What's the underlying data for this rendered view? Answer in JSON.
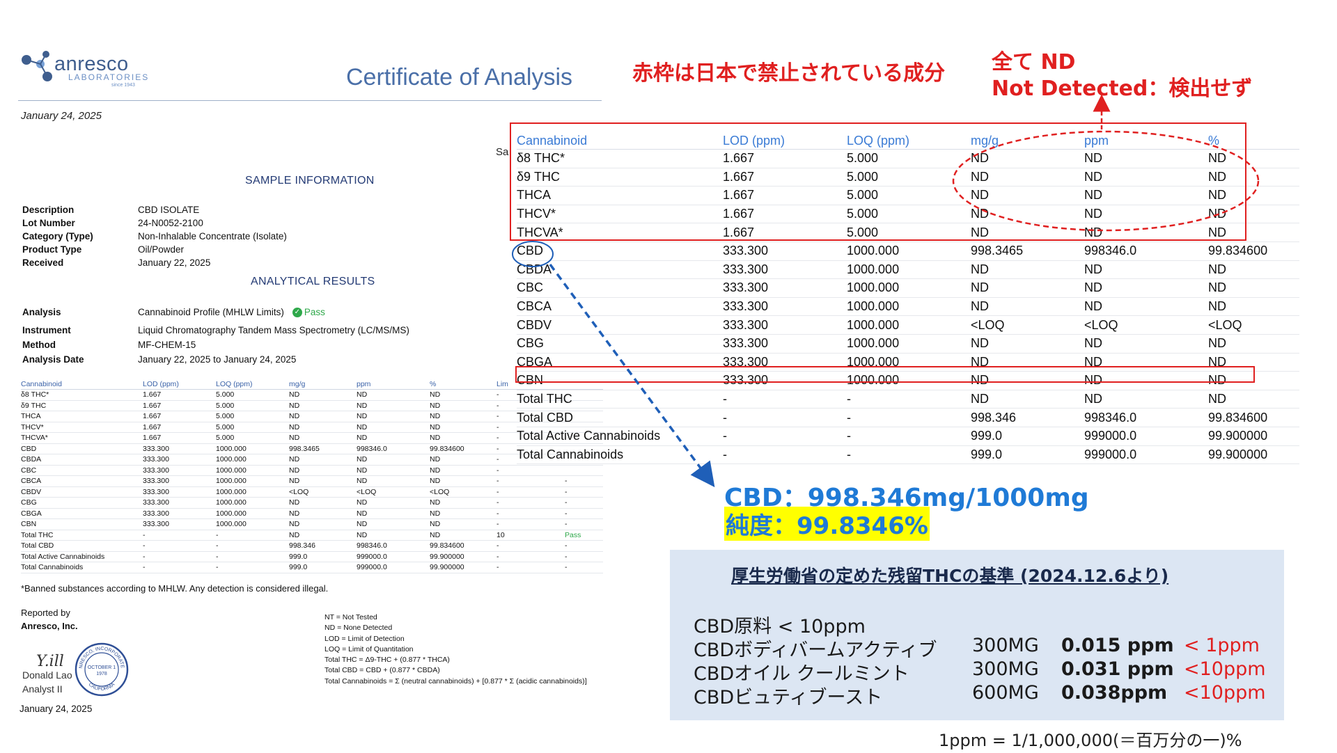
{
  "logo": {
    "word": "anresco",
    "sub": "LABORATORIES",
    "since": "since 1943"
  },
  "certificate": {
    "title": "Certificate of Analysis",
    "date": "January 24, 2025",
    "sample_heading": "SAMPLE INFORMATION",
    "cut_text": "Sa",
    "info": [
      {
        "label": "Description",
        "value": "CBD ISOLATE"
      },
      {
        "label": "Lot Number",
        "value": "24-N0052-2100"
      },
      {
        "label": "Category (Type)",
        "value": "Non-Inhalable Concentrate (Isolate)"
      },
      {
        "label": "Product Type",
        "value": "Oil/Powder"
      },
      {
        "label": "Received",
        "value": "January 22, 2025"
      }
    ],
    "results_heading": "ANALYTICAL RESULTS",
    "analysis": [
      {
        "label": "Analysis",
        "value": "Cannabinoid Profile (MHLW Limits)",
        "badge": "Pass"
      },
      {
        "label": "Instrument",
        "value": "Liquid Chromatography Tandem Mass Spectrometry (LC/MS/MS)"
      },
      {
        "label": "Method",
        "value": "MF-CHEM-15"
      },
      {
        "label": "Analysis Date",
        "value": "January 22, 2025 to January 24, 2025"
      }
    ],
    "table_headers": [
      "Cannabinoid",
      "LOD (ppm)",
      "LOQ (ppm)",
      "mg/g",
      "ppm",
      "%",
      "Lim",
      "",
      ""
    ],
    "table_rows": [
      [
        "δ8 THC*",
        "1.667",
        "5.000",
        "ND",
        "ND",
        "ND",
        "-",
        "",
        ""
      ],
      [
        "δ9 THC",
        "1.667",
        "5.000",
        "ND",
        "ND",
        "ND",
        "-",
        "",
        ""
      ],
      [
        "THCA",
        "1.667",
        "5.000",
        "ND",
        "ND",
        "ND",
        "-",
        "",
        ""
      ],
      [
        "THCV*",
        "1.667",
        "5.000",
        "ND",
        "ND",
        "ND",
        "-",
        "",
        ""
      ],
      [
        "THCVA*",
        "1.667",
        "5.000",
        "ND",
        "ND",
        "ND",
        "-",
        "",
        ""
      ],
      [
        "CBD",
        "333.300",
        "1000.000",
        "998.3465",
        "998346.0",
        "99.834600",
        "-",
        "",
        ""
      ],
      [
        "CBDA",
        "333.300",
        "1000.000",
        "ND",
        "ND",
        "ND",
        "-",
        "",
        ""
      ],
      [
        "CBC",
        "333.300",
        "1000.000",
        "ND",
        "ND",
        "ND",
        "-",
        "",
        ""
      ],
      [
        "CBCA",
        "333.300",
        "1000.000",
        "ND",
        "ND",
        "ND",
        "-",
        "",
        "-"
      ],
      [
        "CBDV",
        "333.300",
        "1000.000",
        "<LOQ",
        "<LOQ",
        "<LOQ",
        "-",
        "",
        "-"
      ],
      [
        "CBG",
        "333.300",
        "1000.000",
        "ND",
        "ND",
        "ND",
        "-",
        "",
        "-"
      ],
      [
        "CBGA",
        "333.300",
        "1000.000",
        "ND",
        "ND",
        "ND",
        "-",
        "",
        "-"
      ],
      [
        "CBN",
        "333.300",
        "1000.000",
        "ND",
        "ND",
        "ND",
        "-",
        "",
        "-"
      ],
      [
        "Total THC",
        "-",
        "-",
        "ND",
        "ND",
        "ND",
        "10",
        "",
        "Pass"
      ],
      [
        "Total CBD",
        "-",
        "-",
        "998.346",
        "998346.0",
        "99.834600",
        "-",
        "",
        "-"
      ],
      [
        "Total Active Cannabinoids",
        "-",
        "-",
        "999.0",
        "999000.0",
        "99.900000",
        "-",
        "",
        "-"
      ],
      [
        "Total Cannabinoids",
        "-",
        "-",
        "999.0",
        "999000.0",
        "99.900000",
        "-",
        "",
        "-"
      ]
    ],
    "banned_note": "*Banned substances according to MHLW. Any detection is considered illegal.",
    "reported_by": "Reported by",
    "company": "Anresco, Inc.",
    "signer_name": "Donald Lao",
    "signer_title": "Analyst II",
    "sign_date": "January 24, 2025",
    "signature": "Y.ill",
    "seal_text": [
      "ANRESCO, INCORPORATED",
      "OCTOBER 1",
      "1978",
      "CALIFORNIA"
    ],
    "legend": [
      "NT = Not Tested",
      "ND = None Detected",
      "LOD = Limit of Detection",
      "LOQ = Limit of Quantitation",
      "Total THC = Δ9-THC + (0.877 * THCA)",
      "Total CBD = CBD + (0.877 * CBDA)",
      "Total Cannabinoids = Σ (neutral cannabinoids) + [0.877 * Σ (acidic cannabinoids)]"
    ]
  },
  "big_table": {
    "headers": [
      "Cannabinoid",
      "LOD (ppm)",
      "LOQ (ppm)",
      "mg/g",
      "ppm",
      "%"
    ],
    "rows": [
      [
        "δ8 THC*",
        "1.667",
        "5.000",
        "ND",
        "ND",
        "ND"
      ],
      [
        "δ9 THC",
        "1.667",
        "5.000",
        "ND",
        "ND",
        "ND"
      ],
      [
        "THCA",
        "1.667",
        "5.000",
        "ND",
        "ND",
        "ND"
      ],
      [
        "THCV*",
        "1.667",
        "5.000",
        "ND",
        "ND",
        "ND"
      ],
      [
        "THCVA*",
        "1.667",
        "5.000",
        "ND",
        "ND",
        "ND"
      ],
      [
        "CBD",
        "333.300",
        "1000.000",
        "998.3465",
        "998346.0",
        "99.834600"
      ],
      [
        "CBDA",
        "333.300",
        "1000.000",
        "ND",
        "ND",
        "ND"
      ],
      [
        "CBC",
        "333.300",
        "1000.000",
        "ND",
        "ND",
        "ND"
      ],
      [
        "CBCA",
        "333.300",
        "1000.000",
        "ND",
        "ND",
        "ND"
      ],
      [
        "CBDV",
        "333.300",
        "1000.000",
        "<LOQ",
        "<LOQ",
        "<LOQ"
      ],
      [
        "CBG",
        "333.300",
        "1000.000",
        "ND",
        "ND",
        "ND"
      ],
      [
        "CBGA",
        "333.300",
        "1000.000",
        "ND",
        "ND",
        "ND"
      ],
      [
        "CBN",
        "333.300",
        "1000.000",
        "ND",
        "ND",
        "ND"
      ],
      [
        "Total THC",
        "-",
        "-",
        "ND",
        "ND",
        "ND"
      ],
      [
        "Total CBD",
        "-",
        "-",
        "998.346",
        "998346.0",
        "99.834600"
      ],
      [
        "Total Active Cannabinoids",
        "-",
        "-",
        "999.0",
        "999000.0",
        "99.900000"
      ],
      [
        "Total Cannabinoids",
        "-",
        "-",
        "999.0",
        "999000.0",
        "99.900000"
      ]
    ]
  },
  "annotations": {
    "banned_red_box": "赤枠は日本で禁止されている成分",
    "all_nd_line1": "全て ND",
    "all_nd_line2": "Not Detected：検出せず",
    "cbd_amount": "CBD：998.346mg/1000mg",
    "purity": "純度：99.8346%"
  },
  "mhlw_panel": {
    "title": "厚生労働省の定めた残留THCの基準 (2024.12.6より)",
    "rows": [
      {
        "name": "CBD原料 < 10ppm",
        "size": "",
        "value": "",
        "limit": ""
      },
      {
        "name": "CBDボディバームアクティブ",
        "size": "300MG",
        "value": "0.015 ppm",
        "limit": "< 1ppm"
      },
      {
        "name": "CBDオイル クールミント",
        "size": "300MG",
        "value": "0.031 ppm",
        "limit": "<10ppm"
      },
      {
        "name": "CBDビュティブースト",
        "size": "600MG",
        "value": "0.038ppm",
        "limit": "<10ppm"
      }
    ],
    "footnote": "1ppm = 1/1,000,000(＝百万分の一)%"
  },
  "colors": {
    "brand_blue": "#4a6fa8",
    "header_blue": "#3a7bd5",
    "annotation_red": "#e02020",
    "annotation_blue": "#1f7ad6",
    "pass_green": "#2ea84a",
    "panel_bg": "#dce6f3",
    "highlight_yellow": "#ffff00"
  }
}
